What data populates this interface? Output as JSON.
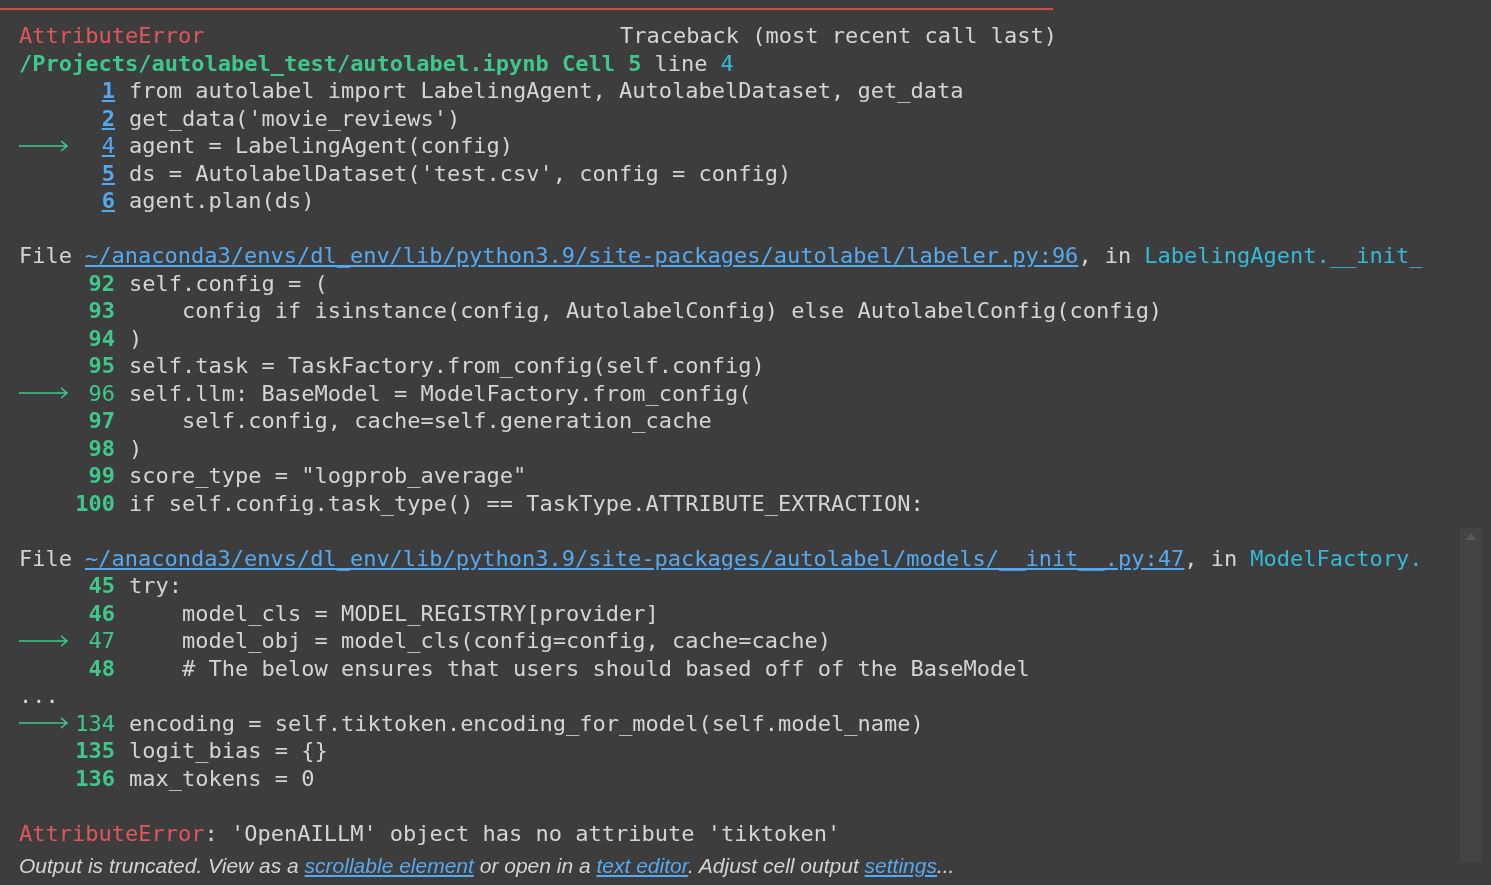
{
  "header": {
    "error_name": "AttributeError",
    "title": "Traceback (most recent call last)"
  },
  "location": {
    "path": "/Projects/autolabel_test/autolabel.ipynb Cell 5",
    "word": "line",
    "line": "4"
  },
  "frames": [
    {
      "kind": "cell",
      "lines": [
        {
          "kind": "code",
          "number": "1",
          "code": "from autolabel import LabelingAgent, AutolabelDataset, get_data",
          "current": false
        },
        {
          "kind": "code",
          "number": "2",
          "code": "get_data('movie_reviews')",
          "current": false
        },
        {
          "kind": "code",
          "number": "4",
          "code": "agent = LabelingAgent(config)",
          "current": true
        },
        {
          "kind": "code",
          "number": "5",
          "code": "ds = AutolabelDataset('test.csv', config = config)",
          "current": false
        },
        {
          "kind": "code",
          "number": "6",
          "code": "agent.plan(ds)",
          "current": false
        }
      ]
    },
    {
      "kind": "file",
      "file": {
        "label": "File",
        "path": "~/anaconda3/envs/dl_env/lib/python3.9/site-packages/autolabel/labeler.py:96",
        "sep": ", in",
        "function": "LabelingAgent.__init_"
      },
      "lines": [
        {
          "kind": "code",
          "number": "92",
          "code": "self.config = (",
          "current": false
        },
        {
          "kind": "code",
          "number": "93",
          "code": "    config if isinstance(config, AutolabelConfig) else AutolabelConfig(config)",
          "current": false
        },
        {
          "kind": "code",
          "number": "94",
          "code": ")",
          "current": false
        },
        {
          "kind": "code",
          "number": "95",
          "code": "self.task = TaskFactory.from_config(self.config)",
          "current": false
        },
        {
          "kind": "code",
          "number": "96",
          "code": "self.llm: BaseModel = ModelFactory.from_config(",
          "current": true
        },
        {
          "kind": "code",
          "number": "97",
          "code": "    self.config, cache=self.generation_cache",
          "current": false
        },
        {
          "kind": "code",
          "number": "98",
          "code": ")",
          "current": false
        },
        {
          "kind": "code",
          "number": "99",
          "code": "score_type = \"logprob_average\"",
          "current": false
        },
        {
          "kind": "code",
          "number": "100",
          "code": "if self.config.task_type() == TaskType.ATTRIBUTE_EXTRACTION:",
          "current": false
        }
      ]
    },
    {
      "kind": "file",
      "file": {
        "label": "File",
        "path": "~/anaconda3/envs/dl_env/lib/python3.9/site-packages/autolabel/models/__init__.py:47",
        "sep": ", in",
        "function": "ModelFactory."
      },
      "lines": [
        {
          "kind": "code",
          "number": "45",
          "code": "try:",
          "current": false
        },
        {
          "kind": "code",
          "number": "46",
          "code": "    model_cls = MODEL_REGISTRY[provider]",
          "current": false
        },
        {
          "kind": "code",
          "number": "47",
          "code": "    model_obj = model_cls(config=config, cache=cache)",
          "current": true
        },
        {
          "kind": "code",
          "number": "48",
          "code": "    # The below ensures that users should based off of the BaseModel",
          "current": false
        },
        {
          "kind": "ellipsis",
          "text": "..."
        },
        {
          "kind": "code",
          "number": "134",
          "code": "encoding = self.tiktoken.encoding_for_model(self.model_name)",
          "current": true
        },
        {
          "kind": "code",
          "number": "135",
          "code": "logit_bias = {}",
          "current": false
        },
        {
          "kind": "code",
          "number": "136",
          "code": "max_tokens = 0",
          "current": false
        }
      ]
    }
  ],
  "error": {
    "name": "AttributeError",
    "message": ": 'OpenAILLM' object has no attribute 'tiktoken'"
  },
  "footer": [
    {
      "text": "Output is truncated. View as a ",
      "link": false
    },
    {
      "text": "scrollable element",
      "link": true
    },
    {
      "text": " or open in a ",
      "link": false
    },
    {
      "text": "text editor",
      "link": true
    },
    {
      "text": ". Adjust cell output ",
      "link": false
    },
    {
      "text": "settings",
      "link": true
    },
    {
      "text": "...",
      "link": false
    }
  ]
}
